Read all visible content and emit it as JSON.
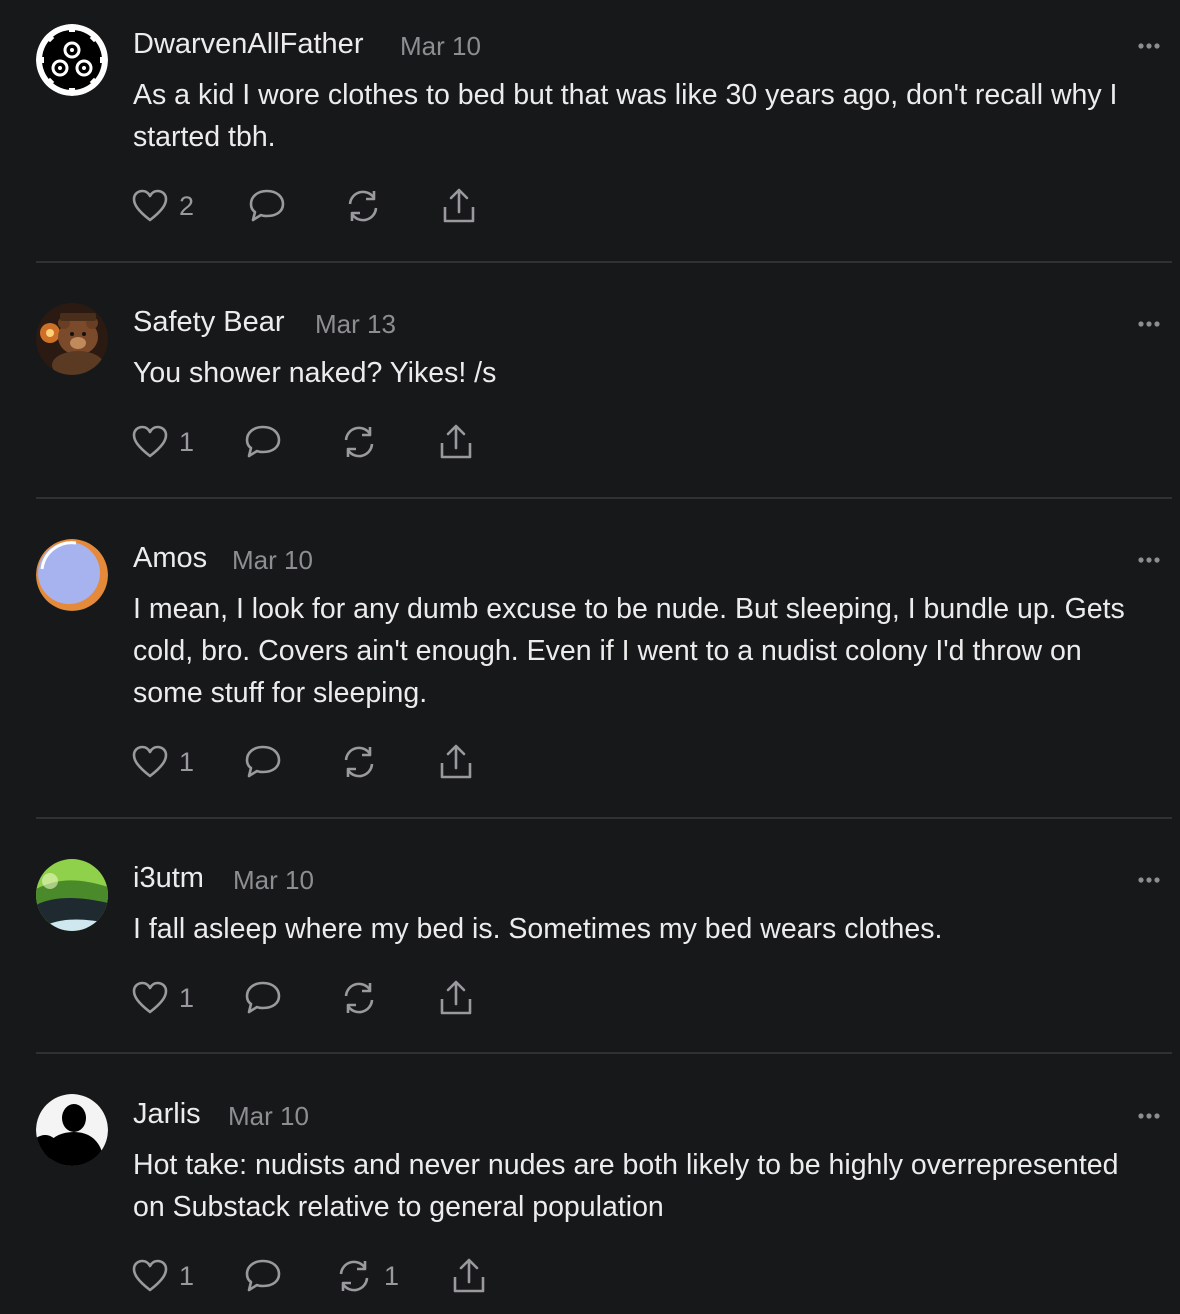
{
  "comments": [
    {
      "author": "DwarvenAllFather",
      "date": "Mar 10",
      "text": "As a kid I wore clothes to bed but that was like 30 years ago, don't recall why I started tbh.",
      "likes": "2",
      "restacks": "",
      "avatar_icon": "gear-avatar-icon"
    },
    {
      "author": "Safety Bear",
      "date": "Mar 13",
      "text": "You shower naked? Yikes! /s",
      "likes": "1",
      "restacks": "",
      "avatar_icon": "bear-avatar-icon"
    },
    {
      "author": "Amos",
      "date": "Mar 10",
      "text": "I mean, I look for any dumb excuse to be nude. But sleeping, I bundle up. Gets cold, bro. Covers ain't enough. Even if I went to a nudist colony I'd throw on some stuff for sleeping.",
      "likes": "1",
      "restacks": "",
      "avatar_icon": "colored-circle-avatar-icon"
    },
    {
      "author": "i3utm",
      "date": "Mar 10",
      "text": "I fall asleep where my bed is. Sometimes my bed wears clothes.",
      "likes": "1",
      "restacks": "",
      "avatar_icon": "landscape-avatar-icon"
    },
    {
      "author": "Jarlis",
      "date": "Mar 10",
      "text": "Hot take: nudists and never nudes are both likely to be highly overrepresented on Substack relative to general population",
      "likes": "1",
      "restacks": "1",
      "avatar_icon": "silhouette-avatar-icon"
    }
  ],
  "icons": {
    "like": "heart-icon",
    "reply": "speech-bubble-icon",
    "restack": "refresh-arrows-icon",
    "share": "share-upload-icon",
    "more": "ellipsis-icon"
  },
  "colors": {
    "background": "#17181a",
    "text": "#ececec",
    "muted": "#8e8e92",
    "divider": "#303134"
  }
}
